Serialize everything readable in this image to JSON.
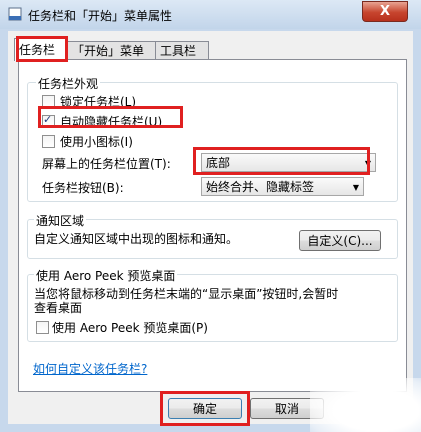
{
  "window": {
    "title": "任务栏和「开始」菜单属性",
    "close_label": "X"
  },
  "tabs": [
    {
      "label": "任务栏",
      "active": true
    },
    {
      "label": "「开始」菜单",
      "active": false
    },
    {
      "label": "工具栏",
      "active": false
    }
  ],
  "appearance": {
    "group_label": "任务栏外观",
    "lock_taskbar": {
      "label": "锁定任务栏(L)",
      "checked": false
    },
    "auto_hide": {
      "label": "自动隐藏任务栏(U)",
      "checked": true
    },
    "small_icons": {
      "label": "使用小图标(I)",
      "checked": false
    },
    "location_label": "屏幕上的任务栏位置(T):",
    "location_value": "底部",
    "buttons_label": "任务栏按钮(B):",
    "buttons_value": "始终合并、隐藏标签"
  },
  "notification": {
    "group_label": "通知区域",
    "description": "自定义通知区域中出现的图标和通知。",
    "customize_button": "自定义(C)..."
  },
  "aero_peek": {
    "group_label": "使用 Aero Peek 预览桌面",
    "description_line1": "当您将鼠标移动到任务栏末端的“显示桌面”按钮时,会暂时",
    "description_line2": "查看桌面",
    "checkbox": {
      "label": "使用 Aero Peek 预览桌面(P)",
      "checked": false
    }
  },
  "help_link": "如何自定义该任务栏?",
  "footer": {
    "ok_label": "确定",
    "cancel_label": "取消"
  },
  "colors": {
    "highlight": "#e02020",
    "link": "#0066cc",
    "title_bar": "#c7d8ec"
  }
}
